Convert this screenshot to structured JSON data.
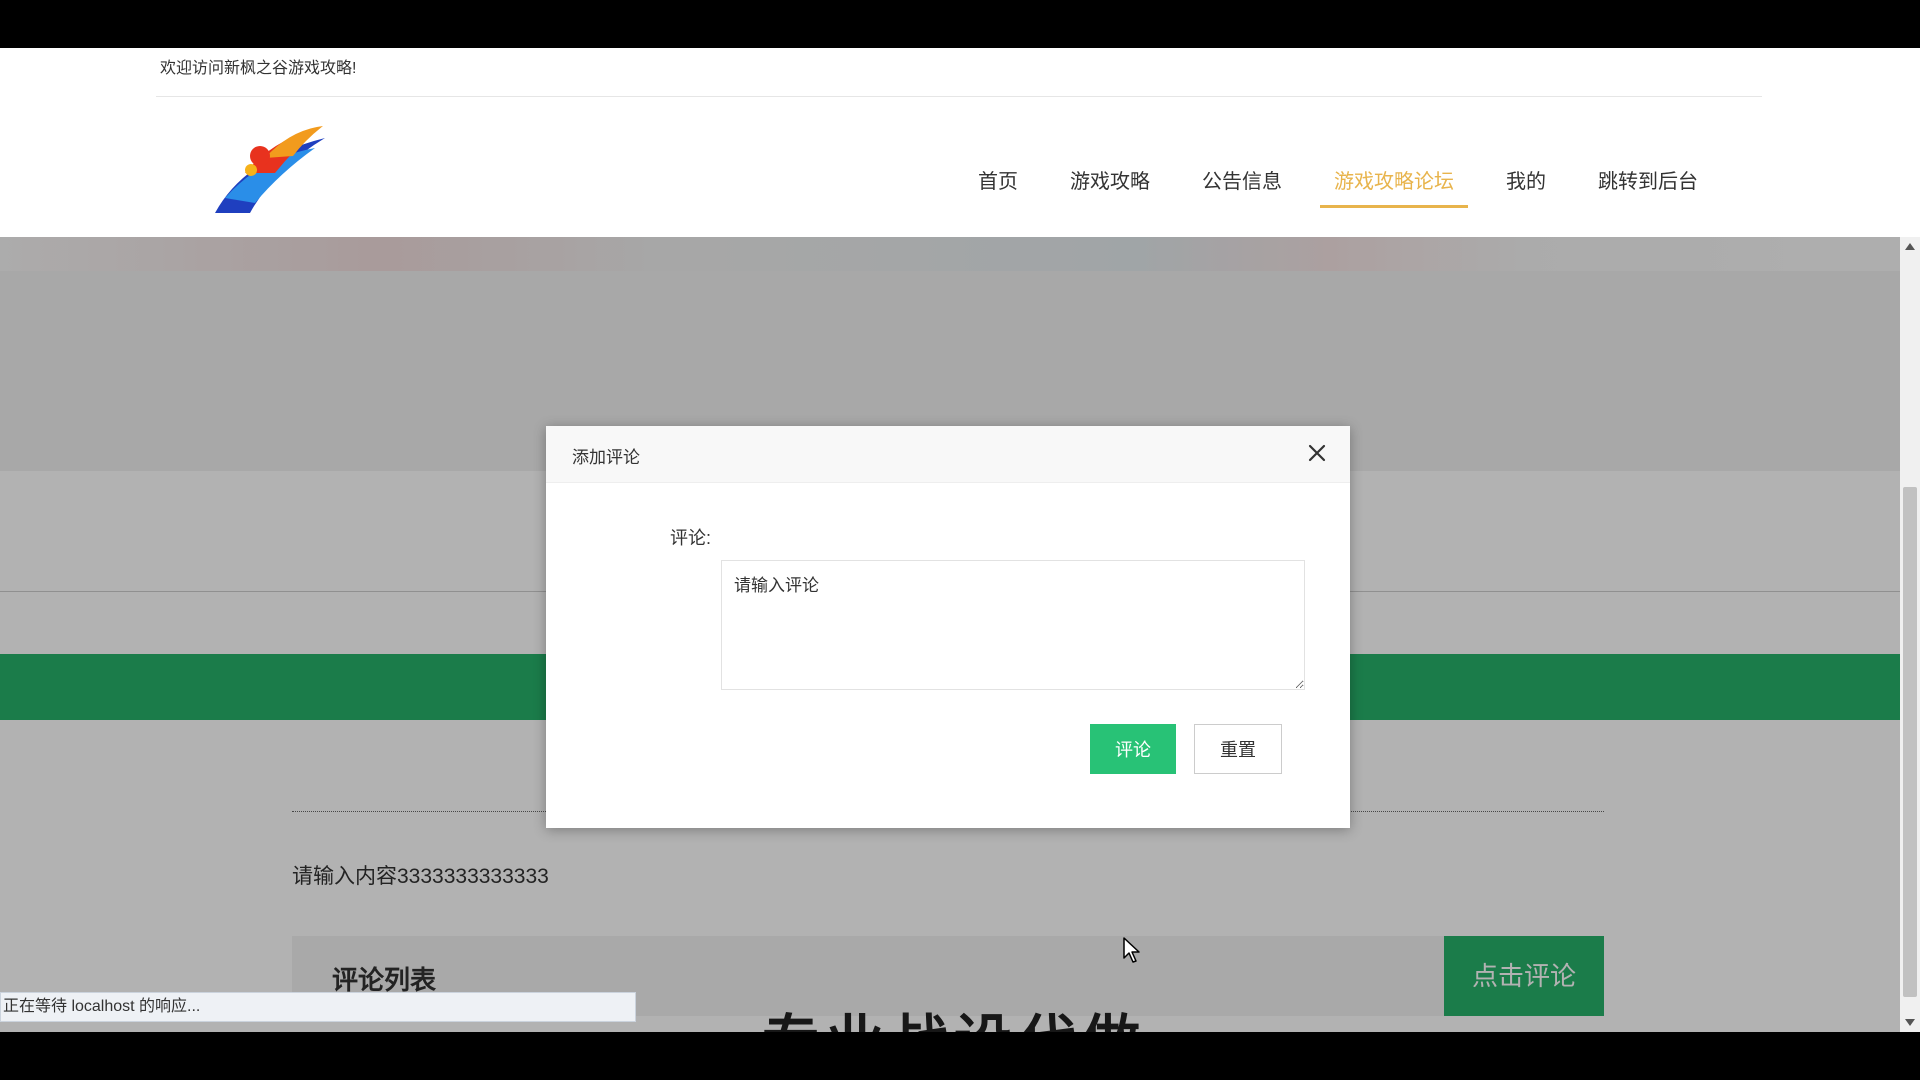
{
  "header": {
    "welcome_text": "欢迎访问新枫之谷游戏攻略!",
    "nav": [
      {
        "label": "首页",
        "active": false
      },
      {
        "label": "游戏攻略",
        "active": false
      },
      {
        "label": "公告信息",
        "active": false
      },
      {
        "label": "游戏攻略论坛",
        "active": true
      },
      {
        "label": "我的",
        "active": false
      },
      {
        "label": "跳转到后台",
        "active": false
      }
    ],
    "accent_color": "#e8b44c"
  },
  "page": {
    "post_content": "请输入内容3333333333333",
    "comment_list_title": "评论列表",
    "click_comment_label": "点击评论",
    "bottom_banner_text": "专业战设代做",
    "green_color": "#28b26a"
  },
  "modal": {
    "title": "添加评论",
    "field_label": "评论:",
    "textarea_placeholder": "请输入评论",
    "submit_label": "评论",
    "reset_label": "重置"
  },
  "status_bar": {
    "text": "正在等待 localhost 的响应..."
  }
}
